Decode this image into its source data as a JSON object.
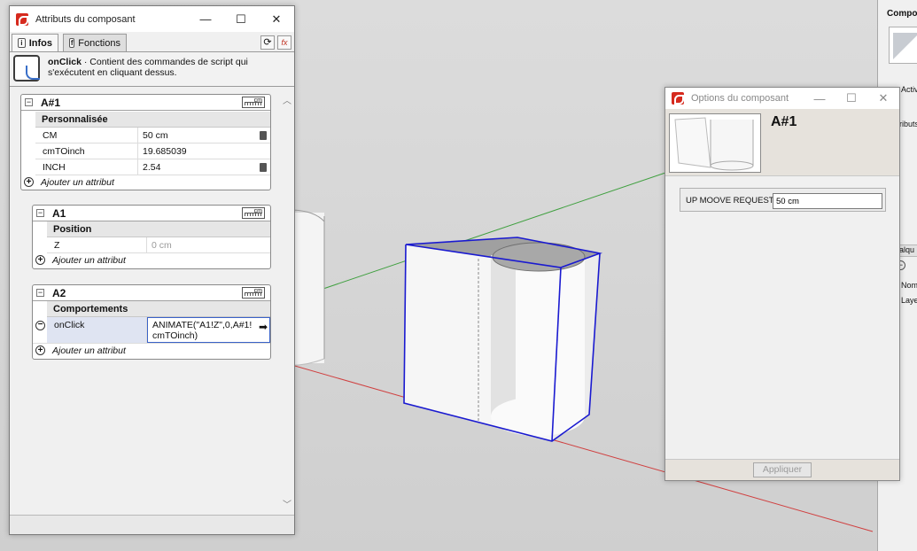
{
  "attributes_window": {
    "title": "Attributs du composant",
    "controls": {
      "minimize": "—",
      "maximize": "☐",
      "close": "✕"
    },
    "tabs": [
      {
        "label": "Infos",
        "icon": "info-icon",
        "active": true
      },
      {
        "label": "Fonctions",
        "icon": "function-icon",
        "active": false
      }
    ],
    "tools": {
      "refresh": "⟳",
      "formula": "fx"
    },
    "info": {
      "name": "onClick",
      "description": " · Contient des commandes de script qui s'exécutent en cliquant dessus."
    },
    "add_attribute_label": "Ajouter un attribut",
    "unit_badge": "cm",
    "groups": [
      {
        "name": "A#1",
        "category": "Personnalisée",
        "rows": [
          {
            "key": "CM",
            "value": "50 cm",
            "has_button": true
          },
          {
            "key": "cmTOinch",
            "value": "19.685039",
            "has_button": false
          },
          {
            "key": "INCH",
            "value": "2.54",
            "has_button": true
          }
        ]
      },
      {
        "name": "A1",
        "category": "Position",
        "rows": [
          {
            "key": "Z",
            "value": "0 cm",
            "dimmed": true
          }
        ]
      },
      {
        "name": "A2",
        "category": "Comportements",
        "rows": [
          {
            "key": "onClick",
            "value_line1": "ANIMATE(\"A1!Z\",0,A#1!",
            "value_line2": "cmTOinch)"
          }
        ]
      }
    ]
  },
  "options_window": {
    "title": "Options du composant",
    "component_name": "A#1",
    "field_label": "UP MOOVE REQUESTED",
    "field_value": "50 cm",
    "apply_label": "Appliquer"
  },
  "tray": {
    "title": "Composa",
    "labels": [
      "Activ",
      "ributs",
      "alqu",
      "Nom",
      "Laye"
    ]
  },
  "colors": {
    "selection": "#1a1ad0",
    "red_axis": "#d04040",
    "green_axis": "#40a040",
    "window_bg": "#f0f0f0"
  }
}
